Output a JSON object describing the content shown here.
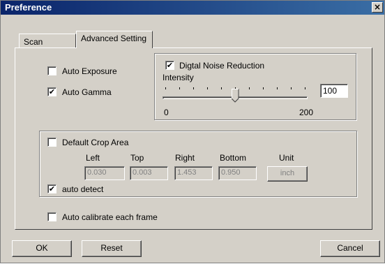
{
  "window": {
    "title": "Preference",
    "close_glyph": "×"
  },
  "tabs": [
    {
      "label": "Scan Setting",
      "active": false
    },
    {
      "label": "Advanced Setting",
      "active": true
    }
  ],
  "exposure": {
    "auto_exposure_label": "Auto Exposure",
    "auto_exposure_checked": false,
    "auto_gamma_label": "Auto Gamma",
    "auto_gamma_checked": true
  },
  "noise": {
    "label": "Digtal Noise Reduction",
    "checked": true,
    "intensity_label": "Intensity",
    "intensity_value": "100",
    "min_label": "0",
    "max_label": "200",
    "min": 0,
    "max": 200,
    "value": 100
  },
  "crop": {
    "default_crop_label": "Default Crop Area",
    "default_crop_checked": false,
    "headers": {
      "left": "Left",
      "top": "Top",
      "right": "Right",
      "bottom": "Bottom",
      "unit": "Unit"
    },
    "values": {
      "left": "0.030",
      "top": "0.003",
      "right": "1.453",
      "bottom": "0.950"
    },
    "unit_button": "inch",
    "auto_detect_label": "auto detect",
    "auto_detect_checked": true
  },
  "calibrate": {
    "label": "Auto calibrate each frame",
    "checked": false
  },
  "buttons": {
    "ok": "OK",
    "reset": "Reset",
    "cancel": "Cancel"
  },
  "glyphs": {
    "check": "✔"
  }
}
